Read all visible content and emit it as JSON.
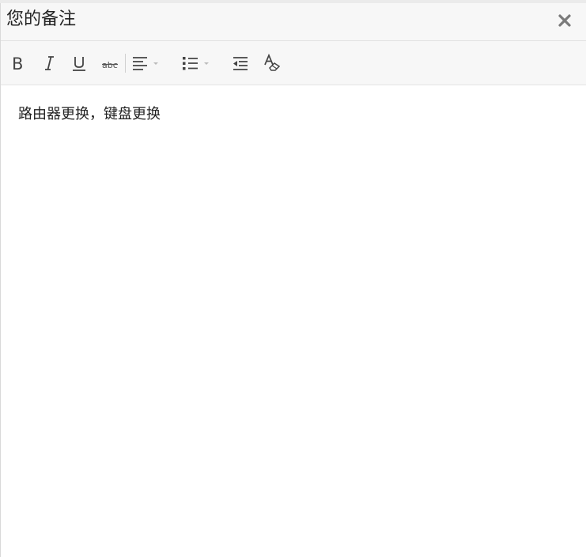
{
  "dialog": {
    "title": "您的备注"
  },
  "toolbar": {
    "tools": [
      {
        "name": "bold-button",
        "icon": "bold-icon"
      },
      {
        "name": "italic-button",
        "icon": "italic-icon"
      },
      {
        "name": "underline-button",
        "icon": "underline-icon"
      },
      {
        "name": "strikethrough-button",
        "icon": "strikethrough-icon"
      },
      {
        "name": "align-dropdown",
        "icon": "align-left-icon"
      },
      {
        "name": "list-dropdown",
        "icon": "bulleted-list-icon"
      },
      {
        "name": "outdent-button",
        "icon": "outdent-icon"
      },
      {
        "name": "clear-format-button",
        "icon": "clear-format-icon"
      }
    ]
  },
  "editor": {
    "content": "路由器更换，键盘更换"
  },
  "colors": {
    "header_bg": "#f7f7f7",
    "border": "#e3e3e3",
    "icon": "#555555",
    "text": "#222222"
  }
}
